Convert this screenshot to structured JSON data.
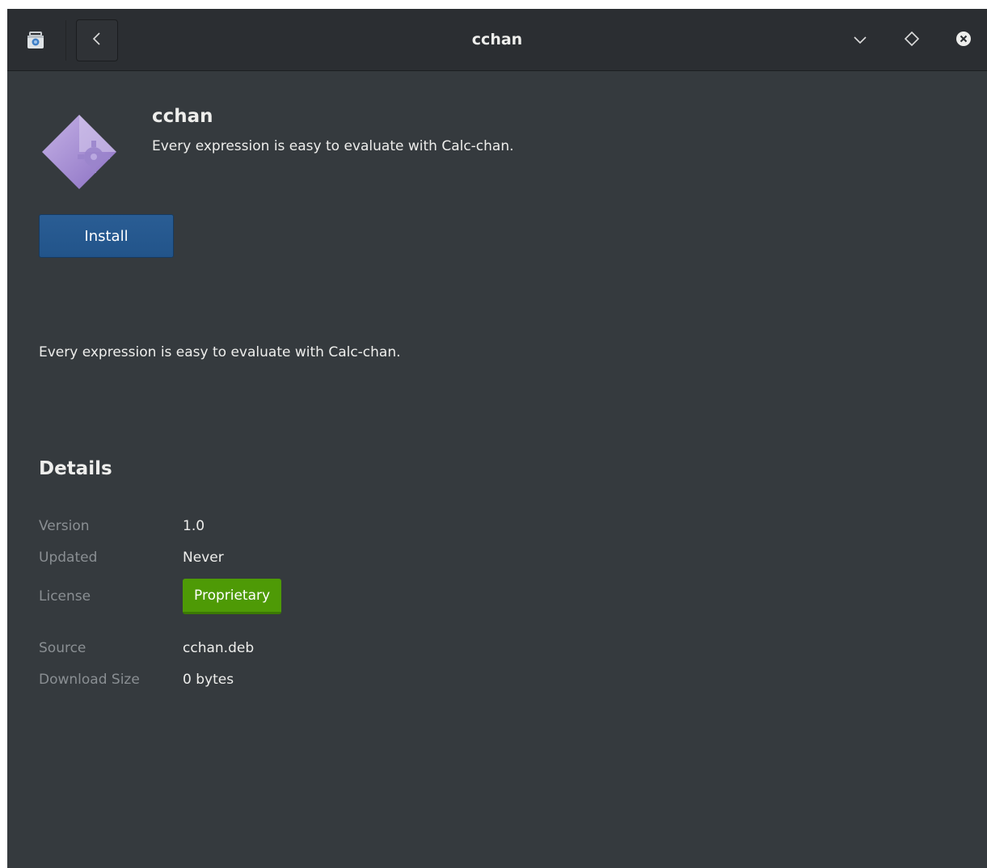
{
  "header": {
    "title": "cchan",
    "app_icon": "software-center-bag-icon",
    "back_icon": "chevron-left-icon",
    "minimize_icon": "chevron-down-icon",
    "maximize_icon": "diamond-icon",
    "close_icon": "close-circle-icon"
  },
  "app": {
    "name": "cchan",
    "summary": "Every expression is easy to evaluate with Calc-chan.",
    "icon": "application-diamond-gear-icon",
    "install_label": "Install",
    "description": "Every expression is easy to evaluate with Calc-chan."
  },
  "details": {
    "heading": "Details",
    "rows": [
      {
        "label": "Version",
        "value": "1.0"
      },
      {
        "label": "Updated",
        "value": "Never"
      },
      {
        "label": "License",
        "value": "Proprietary"
      },
      {
        "label": "Source",
        "value": "cchan.deb"
      },
      {
        "label": "Download Size",
        "value": "0 bytes"
      }
    ]
  },
  "colors": {
    "background": "#353a3e",
    "headerbar": "#2b2e32",
    "install_button": "#245891",
    "license_badge": "#4e9a06",
    "label_text": "#8a8f93",
    "text": "#eeeeec"
  }
}
